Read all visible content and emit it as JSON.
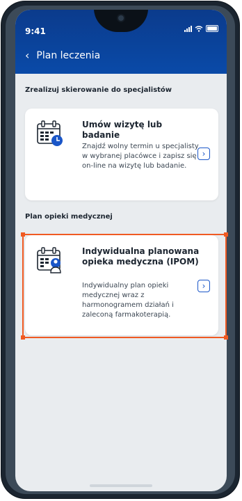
{
  "status_bar": {
    "time": "9:41"
  },
  "header": {
    "title": "Plan leczenia"
  },
  "sections": [
    {
      "title": "Zrealizuj skierowanie do specjalistów",
      "card": {
        "title": "Umów wizytę lub badanie",
        "description": "Znajdź wolny termin u specjalisty w wybranej placówce i zapisz się on-line na wizytę lub badanie.",
        "icon": "calendar-clock-icon"
      }
    },
    {
      "title": "Plan opieki medycznej",
      "card": {
        "title": "Indywidualna planowana opieka medyczna (IPOM)",
        "description": "Indywidualny plan opieki medycznej wraz z harmonogramem działań i zaleconą farmakoterapią.",
        "icon": "calendar-doctor-icon"
      }
    }
  ],
  "colors": {
    "header": "#0a4aa8",
    "accent": "#1a56c8",
    "highlight": "#f05a22",
    "background": "#e9ecef"
  }
}
